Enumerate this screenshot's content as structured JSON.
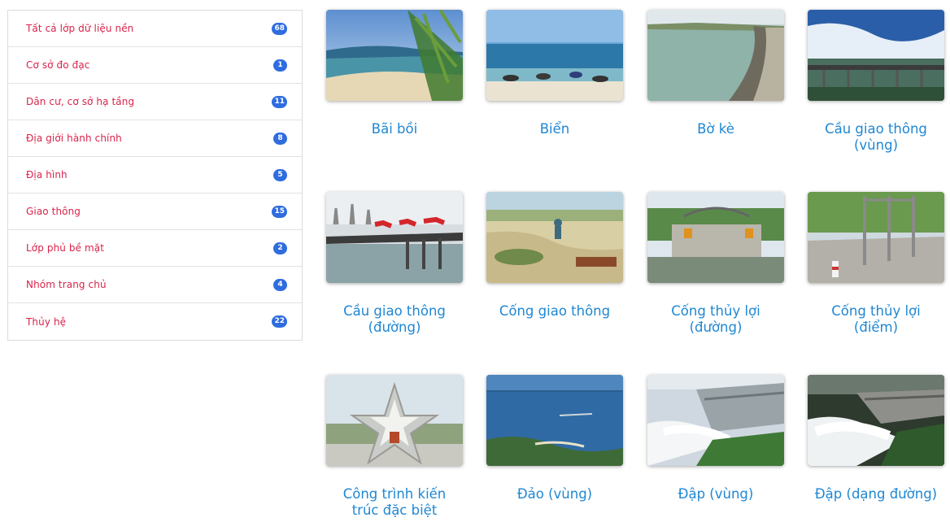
{
  "sidebar": {
    "items": [
      {
        "label": "Tất cả lớp dữ liệu nền",
        "count": "68"
      },
      {
        "label": "Cơ sở đo đạc",
        "count": "1"
      },
      {
        "label": "Dân cư, cơ sở hạ tầng",
        "count": "11"
      },
      {
        "label": "Địa giới hành chính",
        "count": "8"
      },
      {
        "label": "Địa hình",
        "count": "5"
      },
      {
        "label": "Giao thông",
        "count": "15"
      },
      {
        "label": "Lớp phủ bề mặt",
        "count": "2"
      },
      {
        "label": "Nhóm trang chủ",
        "count": "4"
      },
      {
        "label": "Thủy hệ",
        "count": "22"
      }
    ]
  },
  "gallery": {
    "items": [
      {
        "caption": "Bãi bồi"
      },
      {
        "caption": "Biển"
      },
      {
        "caption": "Bờ kè"
      },
      {
        "caption": "Cầu giao thông (vùng)"
      },
      {
        "caption": "Cầu giao thông (đường)"
      },
      {
        "caption": "Cống giao thông"
      },
      {
        "caption": "Cống thủy lợi (đường)"
      },
      {
        "caption": "Cống thủy lợi (điểm)"
      },
      {
        "caption": "Công trình kiến trúc đặc biệt"
      },
      {
        "caption": "Đảo (vùng)"
      },
      {
        "caption": "Đập (vùng)"
      },
      {
        "caption": "Đập (dạng đường)"
      }
    ]
  },
  "colors": {
    "link": "#d8234a",
    "badge": "#2e6cdf",
    "caption": "#1f87d3"
  }
}
